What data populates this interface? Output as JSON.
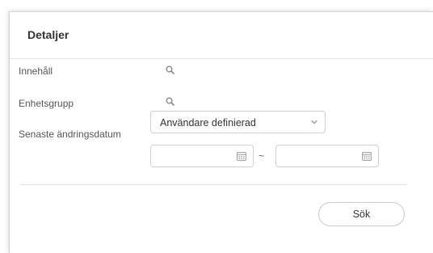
{
  "panel": {
    "title": "Detaljer"
  },
  "filters": {
    "content_label": "Innehåll",
    "device_group_label": "Enhetsgrupp",
    "last_modified_label": "Senaste ändringsdatum",
    "date_select_value": "Användare definierad",
    "date_from_value": "",
    "date_to_value": "",
    "range_separator": "~"
  },
  "actions": {
    "search_label": "Sök"
  },
  "icons": {
    "content_search": "search-icon",
    "device_group_search": "search-icon",
    "select_toggle": "chevron-down-icon",
    "date_from": "calendar-icon",
    "date_to": "calendar-icon"
  },
  "colors": {
    "border": "#cfcfcf",
    "text": "#333333",
    "label": "#555555",
    "icon": "#8a8a8a"
  }
}
